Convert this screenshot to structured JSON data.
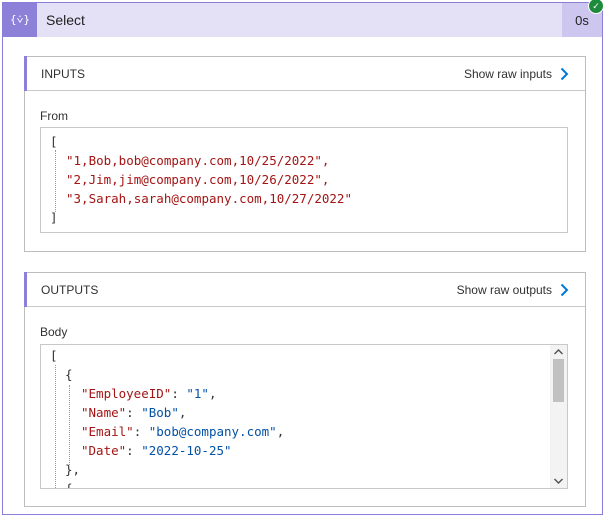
{
  "header": {
    "icon": "{⩒}",
    "title": "Select",
    "duration": "0s",
    "status": "succeeded"
  },
  "inputs": {
    "title": "INPUTS",
    "raw_link": "Show raw inputs",
    "field_label": "From",
    "open_bracket": "[",
    "lines": [
      "\"1,Bob,bob@company.com,10/25/2022\",",
      "\"2,Jim,jim@company.com,10/26/2022\",",
      "\"3,Sarah,sarah@company.com,10/27/2022\""
    ],
    "close_bracket": "]"
  },
  "outputs": {
    "title": "OUTPUTS",
    "raw_link": "Show raw outputs",
    "field_label": "Body",
    "open_bracket": "[",
    "open_brace": "{",
    "entries": [
      {
        "key": "\"EmployeeID\"",
        "value": "\"1\"",
        "trail": ","
      },
      {
        "key": "\"Name\"",
        "value": "\"Bob\"",
        "trail": ","
      },
      {
        "key": "\"Email\"",
        "value": "\"bob@company.com\"",
        "trail": ","
      },
      {
        "key": "\"Date\"",
        "value": "\"2022-10-25\"",
        "trail": ""
      }
    ],
    "close_brace": "},",
    "next_brace": "{"
  },
  "colors": {
    "accent": "#8c80d9",
    "header_bg": "#e4e1f7",
    "success": "#1e8a3c",
    "chevron": "#0078d4"
  }
}
